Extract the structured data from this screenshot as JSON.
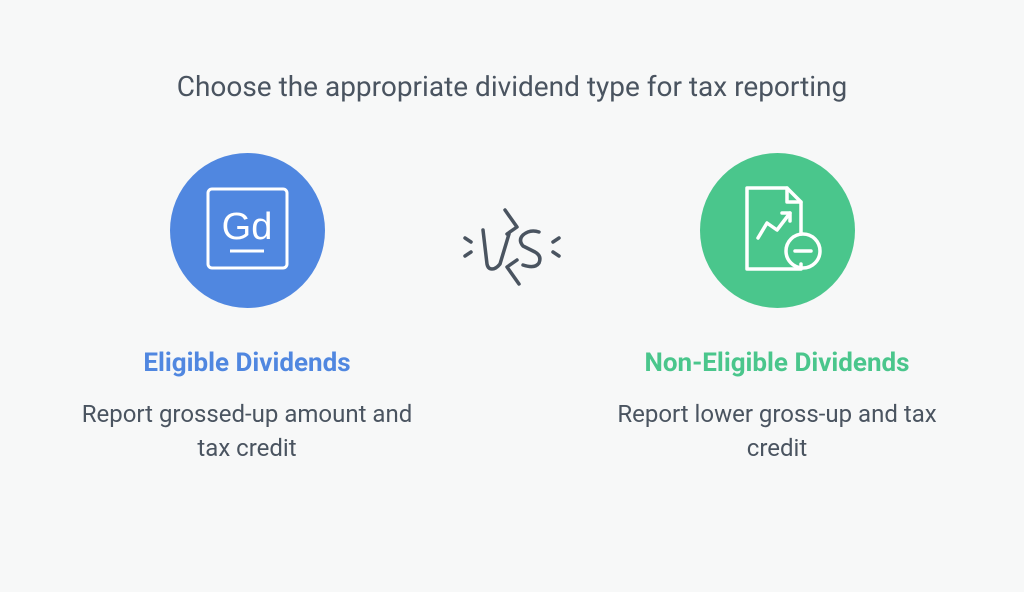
{
  "title": "Choose the appropriate dividend type for tax reporting",
  "vs_label": "VS",
  "left": {
    "icon": "gd-element-icon",
    "title": "Eligible Dividends",
    "description": "Report grossed-up amount and tax credit",
    "color": "#5087e0"
  },
  "right": {
    "icon": "document-chart-minus-icon",
    "title": "Non-Eligible Dividends",
    "description": "Report lower gross-up and tax credit",
    "color": "#4ac68c"
  }
}
